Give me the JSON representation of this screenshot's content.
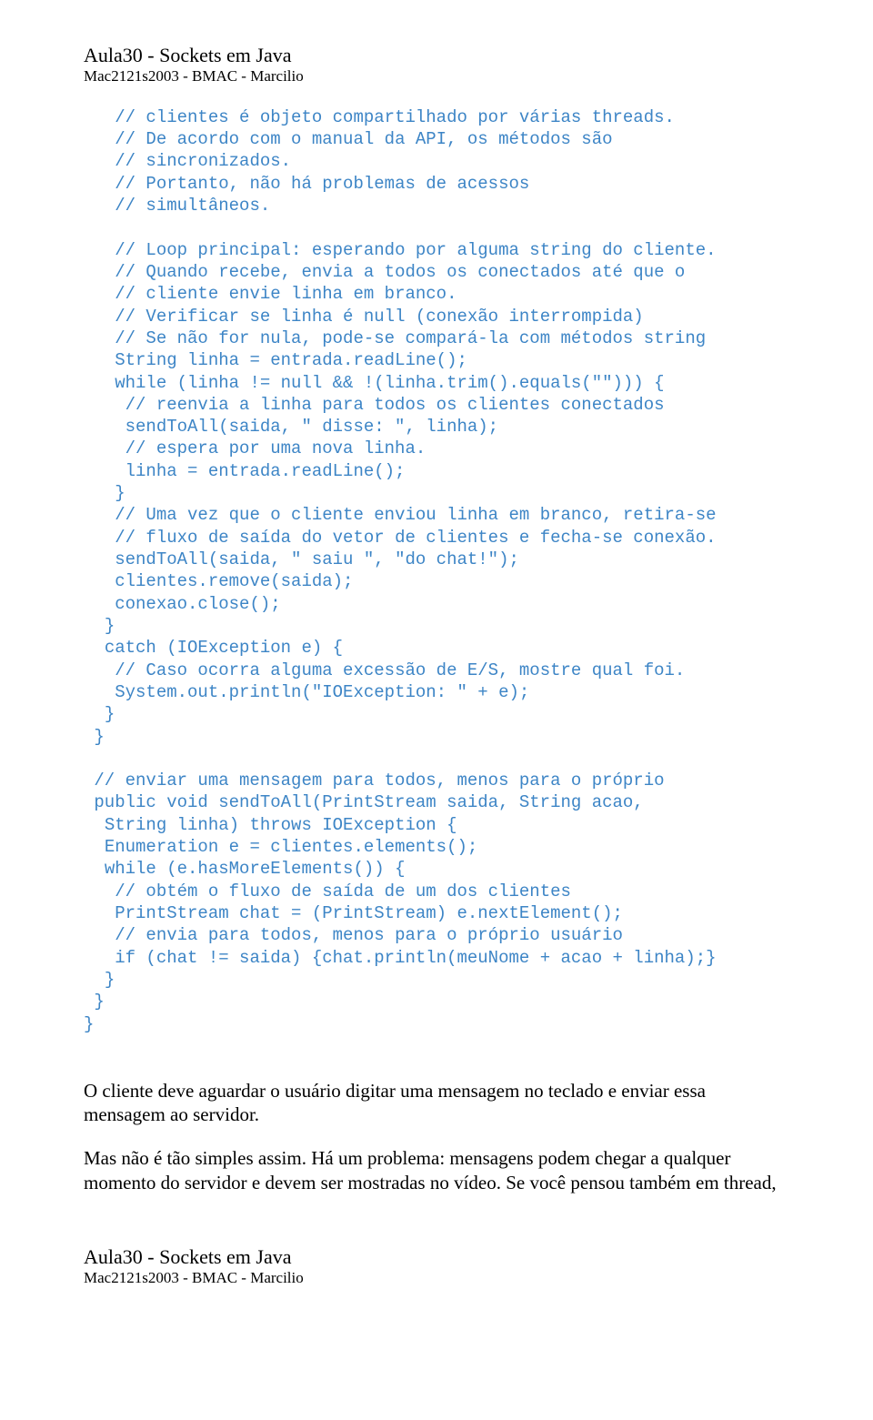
{
  "header": {
    "title": "Aula30 - Sockets em Java",
    "subtitle": "Mac2121s2003 - BMAC - Marcilio"
  },
  "code": "   // clientes é objeto compartilhado por várias threads.\n   // De acordo com o manual da API, os métodos são\n   // sincronizados.\n   // Portanto, não há problemas de acessos\n   // simultâneos.\n\n   // Loop principal: esperando por alguma string do cliente.\n   // Quando recebe, envia a todos os conectados até que o\n   // cliente envie linha em branco.\n   // Verificar se linha é null (conexão interrompida)\n   // Se não for nula, pode-se compará-la com métodos string\n   String linha = entrada.readLine();\n   while (linha != null && !(linha.trim().equals(\"\"))) {\n    // reenvia a linha para todos os clientes conectados\n    sendToAll(saida, \" disse: \", linha);\n    // espera por uma nova linha.\n    linha = entrada.readLine();\n   }\n   // Uma vez que o cliente enviou linha em branco, retira-se\n   // fluxo de saída do vetor de clientes e fecha-se conexão.\n   sendToAll(saida, \" saiu \", \"do chat!\");\n   clientes.remove(saida);\n   conexao.close();\n  }\n  catch (IOException e) {\n   // Caso ocorra alguma excessão de E/S, mostre qual foi.\n   System.out.println(\"IOException: \" + e);\n  }\n }\n\n // enviar uma mensagem para todos, menos para o próprio\n public void sendToAll(PrintStream saida, String acao,\n  String linha) throws IOException {\n  Enumeration e = clientes.elements();\n  while (e.hasMoreElements()) {\n   // obtém o fluxo de saída de um dos clientes\n   PrintStream chat = (PrintStream) e.nextElement();\n   // envia para todos, menos para o próprio usuário\n   if (chat != saida) {chat.println(meuNome + acao + linha);}\n  }\n }\n}",
  "prose": {
    "p1": "O cliente deve aguardar o usuário digitar uma mensagem no teclado e enviar essa mensagem ao servidor.",
    "p2": "Mas não é tão simples assim. Há um problema: mensagens podem chegar a qualquer momento do servidor e devem ser mostradas no vídeo. Se você pensou também em thread,"
  },
  "footer": {
    "title": "Aula30 - Sockets em Java",
    "subtitle": "Mac2121s2003 - BMAC - Marcilio"
  }
}
